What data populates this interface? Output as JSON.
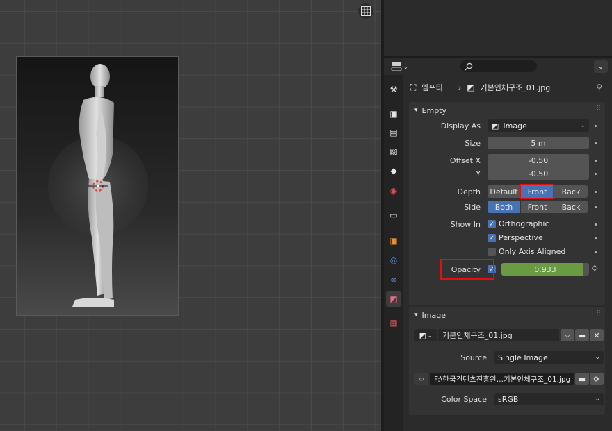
{
  "viewport": {
    "grid_icon": "grid-icon"
  },
  "header": {
    "editor_icon": "properties-editor-icon",
    "search_placeholder": ""
  },
  "breadcrumb": {
    "object": "엠프티",
    "separator": "›",
    "data": "기본인체구조_01.jpg"
  },
  "empty_panel": {
    "title": "Empty",
    "display_as": {
      "label": "Display As",
      "value": "Image"
    },
    "size": {
      "label": "Size",
      "value": "5 m"
    },
    "offset_x": {
      "label": "Offset X",
      "value": "-0.50"
    },
    "offset_y": {
      "label": "Y",
      "value": "-0.50"
    },
    "depth": {
      "label": "Depth",
      "options": [
        "Default",
        "Front",
        "Back"
      ],
      "selected": "Front"
    },
    "side": {
      "label": "Side",
      "options": [
        "Both",
        "Front",
        "Back"
      ],
      "selected": "Both"
    },
    "show_in": {
      "label": "Show In",
      "orthographic": "Orthographic",
      "perspective": "Perspective",
      "only_axis": "Only Axis Aligned"
    },
    "opacity": {
      "label": "Opacity",
      "value": "0.933",
      "fraction": 0.933
    }
  },
  "image_panel": {
    "title": "Image",
    "image_name": "기본인체구조_01.jpg",
    "source": {
      "label": "Source",
      "value": "Single Image"
    },
    "filepath": "F:\\한국컨텐츠진흥원…기본인체구조_01.jpg",
    "color_space": {
      "label": "Color Space",
      "value": "sRGB"
    }
  },
  "colors": {
    "accent": "#4772b3",
    "opacity_bar": "#6a9b43",
    "highlight": "#e01010"
  }
}
